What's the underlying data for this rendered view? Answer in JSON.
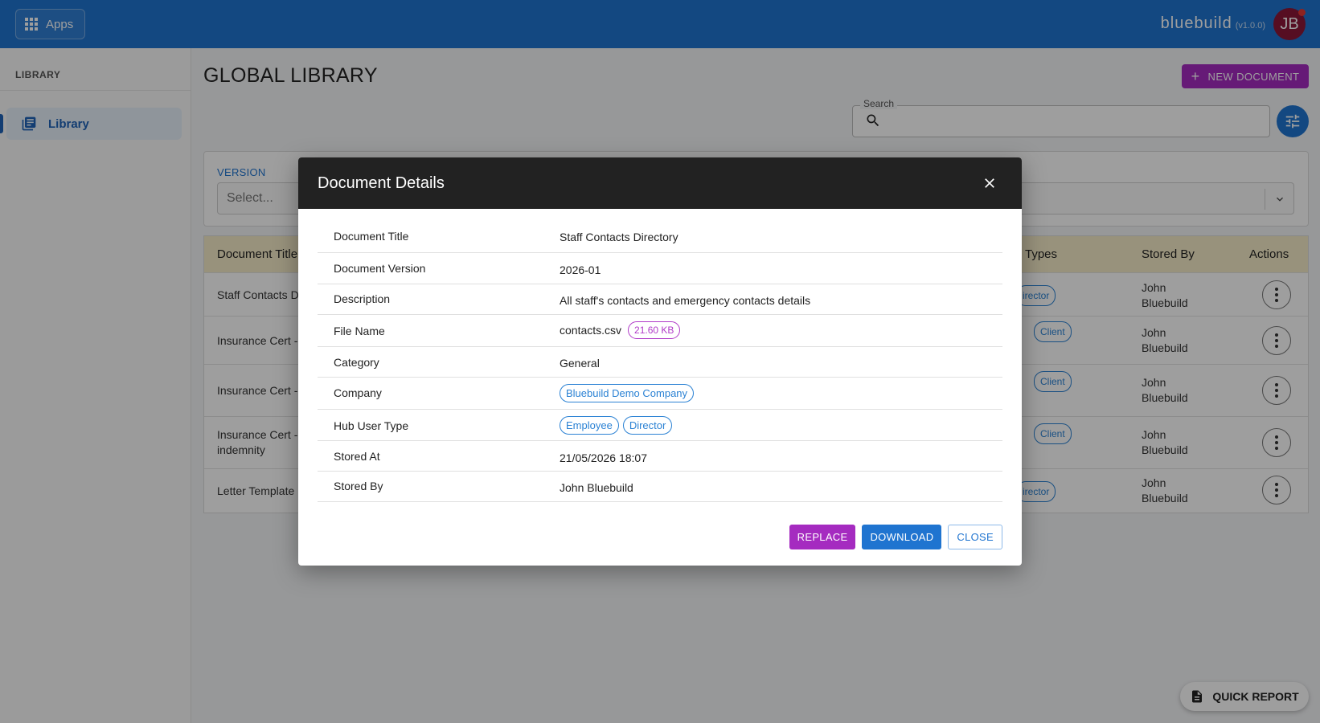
{
  "topbar": {
    "apps_label": "Apps",
    "brand": "bluebuild",
    "version": "(v1.0.0)",
    "avatar_initials": "JB"
  },
  "sidebar": {
    "heading": "LIBRARY",
    "items": [
      {
        "label": "Library",
        "icon": "library-books-icon",
        "active": true
      }
    ]
  },
  "main": {
    "title": "GLOBAL LIBRARY",
    "new_document_label": "NEW DOCUMENT",
    "search": {
      "label": "Search",
      "value": ""
    },
    "filters": {
      "version_label": "VERSION",
      "version_placeholder": "Select..."
    },
    "table": {
      "headers": {
        "document_title": "Document Title",
        "types": "Types",
        "stored_by": "Stored By",
        "actions": "Actions"
      },
      "rows": [
        {
          "title": "Staff Contacts D",
          "title2": "",
          "chips": [
            "irector"
          ],
          "stored_by_1": "John",
          "stored_by_2": "Bluebuild"
        },
        {
          "title": "Insurance Cert -",
          "title2": "",
          "chips": [
            "Client"
          ],
          "stored_by_1": "John",
          "stored_by_2": "Bluebuild"
        },
        {
          "title": "Insurance Cert -",
          "title2": "",
          "chips": [
            "Client"
          ],
          "stored_by_1": "John",
          "stored_by_2": "Bluebuild"
        },
        {
          "title": "Insurance Cert -",
          "title2": "indemnity",
          "chips": [
            "Client"
          ],
          "stored_by_1": "John",
          "stored_by_2": "Bluebuild"
        },
        {
          "title": "Letter Template",
          "title2": "",
          "chips": [
            "irector"
          ],
          "stored_by_1": "John",
          "stored_by_2": "Bluebuild"
        }
      ]
    },
    "quick_report_label": "QUICK REPORT"
  },
  "modal": {
    "title": "Document Details",
    "fields": {
      "document_title": {
        "label": "Document Title",
        "value": "Staff Contacts Directory"
      },
      "document_version": {
        "label": "Document Version",
        "value": "2026-01"
      },
      "description": {
        "label": "Description",
        "value": "All staff's contacts and emergency contacts details"
      },
      "file_name": {
        "label": "File Name",
        "value": "contacts.csv",
        "size": "21.60 KB"
      },
      "category": {
        "label": "Category",
        "value": "General"
      },
      "company": {
        "label": "Company",
        "value": "Bluebuild Demo Company"
      },
      "hub_user_type": {
        "label": "Hub User Type",
        "values": [
          "Employee",
          "Director"
        ]
      },
      "stored_at": {
        "label": "Stored At",
        "value": "21/05/2026 18:07"
      },
      "stored_by": {
        "label": "Stored By",
        "value": "John Bluebuild"
      }
    },
    "actions": {
      "replace": "REPLACE",
      "download": "DOWNLOAD",
      "close": "CLOSE"
    }
  },
  "colors": {
    "primary": "#1f74d0",
    "accent": "#a52bc0",
    "header_bg": "#222222",
    "table_header_bg": "#f6ecc8"
  }
}
